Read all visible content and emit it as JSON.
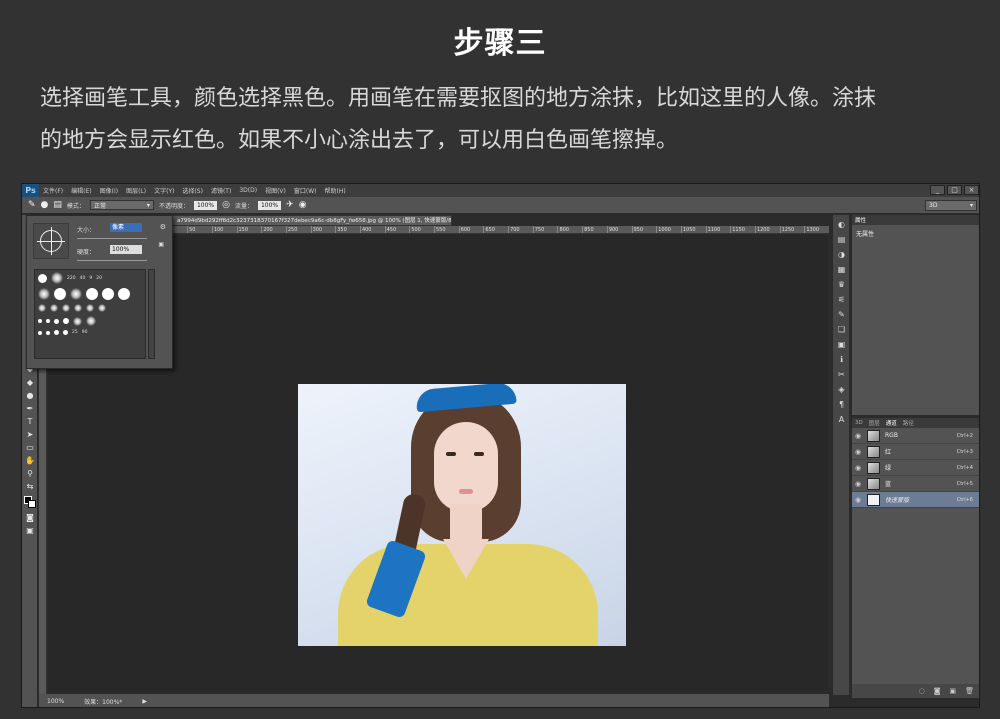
{
  "article": {
    "step_title": "步骤三",
    "description_line1": "选择画笔工具，颜色选择黑色。用画笔在需要抠图的地方涂抹，比如这里的人像。涂抹",
    "description_line2": "的地方会显示红色。如果不小心涂出去了，可以用白色画笔擦掉。"
  },
  "app": {
    "logo": "Ps",
    "menu": [
      "文件(F)",
      "编辑(E)",
      "图像(I)",
      "图层(L)",
      "文字(Y)",
      "选择(S)",
      "滤镜(T)",
      "3D(D)",
      "视图(V)",
      "窗口(W)",
      "帮助(H)"
    ],
    "window_buttons": [
      "_",
      "▢",
      "×"
    ]
  },
  "options": {
    "mode_label": "模式：",
    "mode_value": "正常",
    "opacity_label": "不透明度：",
    "opacity_value": "100%",
    "flow_label": "流量：",
    "flow_value": "100%",
    "workspace": "3D"
  },
  "document": {
    "tab_title": "a7994d9bd292ff8d2c3237318370167f327debec9a6c-db8gFy_fw658.jpg @ 100% (图层 1, 快速蒙版/8) *",
    "ruler_ticks": [
      "50",
      "100",
      "150",
      "200",
      "250",
      "0",
      "50",
      "100",
      "150",
      "200",
      "250",
      "300",
      "350",
      "400",
      "450",
      "500",
      "550",
      "600",
      "650",
      "700",
      "750",
      "800",
      "850",
      "900",
      "950",
      "1000",
      "1050",
      "1100",
      "1150",
      "1200",
      "1250",
      "1300"
    ]
  },
  "brush_picker": {
    "size_label": "大小：",
    "size_value": "像素",
    "hardness_label": "硬度：",
    "hardness_value": "100%",
    "preset_numbers": [
      "220",
      "40",
      "9",
      "20",
      "25",
      "90"
    ]
  },
  "properties_panel": {
    "tab": "属性",
    "content": "无属性"
  },
  "channels_panel": {
    "tabs": [
      "3D",
      "图层",
      "通道",
      "路径"
    ],
    "active_tab": "通道",
    "channels": [
      {
        "name": "RGB",
        "shortcut": "Ctrl+2"
      },
      {
        "name": "红",
        "shortcut": "Ctrl+3"
      },
      {
        "name": "绿",
        "shortcut": "Ctrl+4"
      },
      {
        "name": "蓝",
        "shortcut": "Ctrl+5"
      },
      {
        "name": "快速蒙版",
        "shortcut": "Ctrl+6"
      }
    ]
  },
  "status": {
    "zoom": "100%",
    "info": "效果：100%*"
  }
}
